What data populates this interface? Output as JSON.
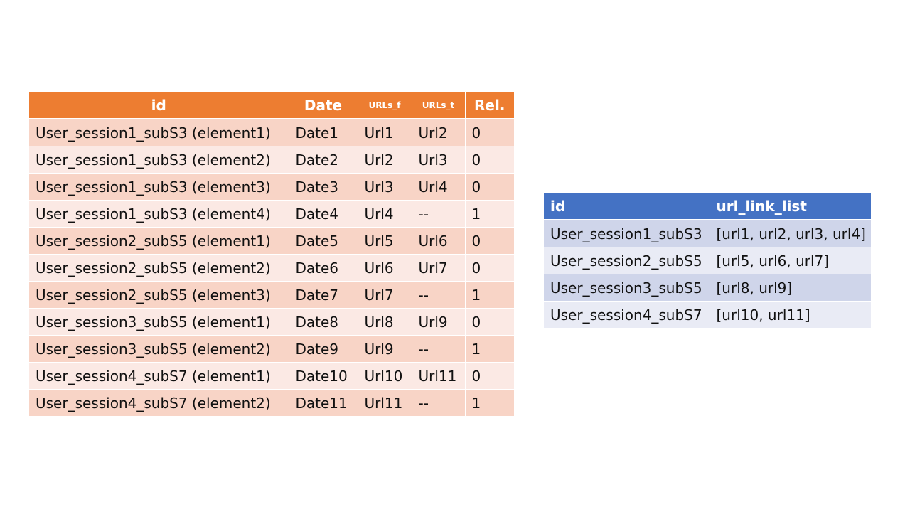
{
  "left_table": {
    "columns": [
      "id",
      "Date",
      "URLs_f",
      "URLs_t",
      "Rel."
    ],
    "rows": [
      [
        "User_session1_subS3 (element1)",
        "Date1",
        "Url1",
        "Url2",
        "0"
      ],
      [
        "User_session1_subS3 (element2)",
        "Date2",
        "Url2",
        "Url3",
        "0"
      ],
      [
        "User_session1_subS3 (element3)",
        "Date3",
        "Url3",
        "Url4",
        "0"
      ],
      [
        "User_session1_subS3 (element4)",
        "Date4",
        "Url4",
        "--",
        "1"
      ],
      [
        "User_session2_subS5 (element1)",
        "Date5",
        "Url5",
        "Url6",
        "0"
      ],
      [
        "User_session2_subS5 (element2)",
        "Date6",
        "Url6",
        "Url7",
        "0"
      ],
      [
        "User_session2_subS5 (element3)",
        "Date7",
        "Url7",
        "--",
        "1"
      ],
      [
        "User_session3_subS5 (element1)",
        "Date8",
        "Url8",
        "Url9",
        "0"
      ],
      [
        "User_session3_subS5 (element2)",
        "Date9",
        "Url9",
        "--",
        "1"
      ],
      [
        "User_session4_subS7 (element1)",
        "Date10",
        "Url10",
        "Url11",
        "0"
      ],
      [
        "User_session4_subS7 (element2)",
        "Date11",
        "Url11",
        "--",
        "1"
      ]
    ]
  },
  "right_table": {
    "columns": [
      "id",
      "url_link_list"
    ],
    "rows": [
      [
        "User_session1_subS3",
        "[url1, url2, url3, url4]"
      ],
      [
        "User_session2_subS5",
        "[url5, url6, url7]"
      ],
      [
        "User_session3_subS5",
        "[url8, url9]"
      ],
      [
        "User_session4_subS7",
        "[url10, url11]"
      ]
    ]
  },
  "colors": {
    "left_header": "#ed7d31",
    "left_row_dark": "#f8d4c6",
    "left_row_light": "#fbe9e4",
    "right_header": "#4472c4",
    "right_row_dark": "#cfd5ea",
    "right_row_light": "#e9ebf5"
  }
}
